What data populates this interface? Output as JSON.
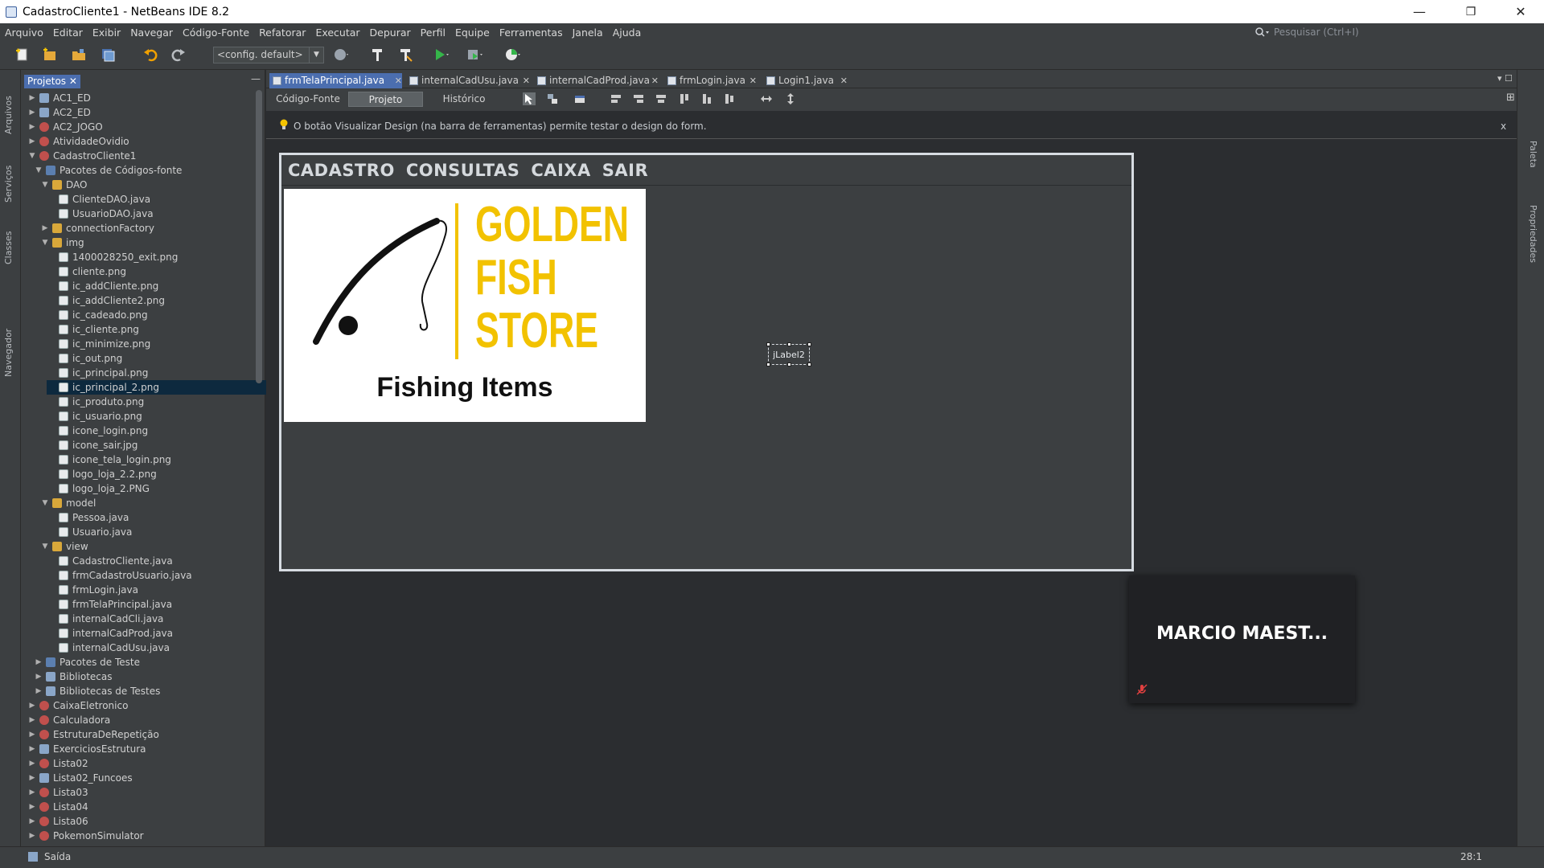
{
  "window": {
    "title": "CadastroCliente1 - NetBeans IDE 8.2",
    "minimize_glyph": "—",
    "restore_glyph": "❐",
    "close_glyph": "✕"
  },
  "menu": [
    {
      "label": "Arquivo"
    },
    {
      "label": "Editar"
    },
    {
      "label": "Exibir"
    },
    {
      "label": "Navegar"
    },
    {
      "label": "Código-Fonte"
    },
    {
      "label": "Refatorar"
    },
    {
      "label": "Executar"
    },
    {
      "label": "Depurar"
    },
    {
      "label": "Perfil"
    },
    {
      "label": "Equipe"
    },
    {
      "label": "Ferramentas"
    },
    {
      "label": "Janela"
    },
    {
      "label": "Ajuda"
    }
  ],
  "search": {
    "placeholder": "Pesquisar (Ctrl+I)"
  },
  "toolbar": {
    "config": "<config. default>"
  },
  "side_left": {
    "files": "Arquivos",
    "services": "Serviços",
    "classes": "Classes",
    "navigator": "Navegador"
  },
  "side_right": {
    "palette": "Paleta",
    "properties": "Propriedades"
  },
  "projects": {
    "tab_label": "Projetos",
    "tree": [
      {
        "label": "AC1_ED",
        "depth": 0,
        "toggle": "▶",
        "icon": "lib"
      },
      {
        "label": "AC2_ED",
        "depth": 0,
        "toggle": "▶",
        "icon": "lib"
      },
      {
        "label": "AC2_JOGO",
        "depth": 0,
        "toggle": "▶",
        "icon": "proj"
      },
      {
        "label": "AtividadeOvidio",
        "depth": 0,
        "toggle": "▶",
        "icon": "proj"
      },
      {
        "label": "CadastroCliente1",
        "depth": 0,
        "toggle": "▼",
        "icon": "proj"
      },
      {
        "label": "Pacotes de Códigos-fonte",
        "depth": 1,
        "toggle": "▼",
        "icon": "src"
      },
      {
        "label": "DAO",
        "depth": 2,
        "toggle": "▼",
        "icon": "pkg"
      },
      {
        "label": "ClienteDAO.java",
        "depth": 3,
        "toggle": "",
        "icon": "file"
      },
      {
        "label": "UsuarioDAO.java",
        "depth": 3,
        "toggle": "",
        "icon": "file"
      },
      {
        "label": "connectionFactory",
        "depth": 2,
        "toggle": "▶",
        "icon": "pkg"
      },
      {
        "label": "img",
        "depth": 2,
        "toggle": "▼",
        "icon": "pkg"
      },
      {
        "label": "1400028250_exit.png",
        "depth": 3,
        "toggle": "",
        "icon": "file"
      },
      {
        "label": "cliente.png",
        "depth": 3,
        "toggle": "",
        "icon": "file"
      },
      {
        "label": "ic_addCliente.png",
        "depth": 3,
        "toggle": "",
        "icon": "file"
      },
      {
        "label": "ic_addCliente2.png",
        "depth": 3,
        "toggle": "",
        "icon": "file"
      },
      {
        "label": "ic_cadeado.png",
        "depth": 3,
        "toggle": "",
        "icon": "file"
      },
      {
        "label": "ic_cliente.png",
        "depth": 3,
        "toggle": "",
        "icon": "file"
      },
      {
        "label": "ic_minimize.png",
        "depth": 3,
        "toggle": "",
        "icon": "file"
      },
      {
        "label": "ic_out.png",
        "depth": 3,
        "toggle": "",
        "icon": "file"
      },
      {
        "label": "ic_principal.png",
        "depth": 3,
        "toggle": "",
        "icon": "file"
      },
      {
        "label": "ic_principal_2.png",
        "depth": 3,
        "toggle": "",
        "icon": "file",
        "selected": true
      },
      {
        "label": "ic_produto.png",
        "depth": 3,
        "toggle": "",
        "icon": "file"
      },
      {
        "label": "ic_usuario.png",
        "depth": 3,
        "toggle": "",
        "icon": "file"
      },
      {
        "label": "icone_login.png",
        "depth": 3,
        "toggle": "",
        "icon": "file"
      },
      {
        "label": "icone_sair.jpg",
        "depth": 3,
        "toggle": "",
        "icon": "file"
      },
      {
        "label": "icone_tela_login.png",
        "depth": 3,
        "toggle": "",
        "icon": "file"
      },
      {
        "label": "logo_loja_2.2.png",
        "depth": 3,
        "toggle": "",
        "icon": "file"
      },
      {
        "label": "logo_loja_2.PNG",
        "depth": 3,
        "toggle": "",
        "icon": "file"
      },
      {
        "label": "model",
        "depth": 2,
        "toggle": "▼",
        "icon": "pkg"
      },
      {
        "label": "Pessoa.java",
        "depth": 3,
        "toggle": "",
        "icon": "file"
      },
      {
        "label": "Usuario.java",
        "depth": 3,
        "toggle": "",
        "icon": "file"
      },
      {
        "label": "view",
        "depth": 2,
        "toggle": "▼",
        "icon": "pkg"
      },
      {
        "label": "CadastroCliente.java",
        "depth": 3,
        "toggle": "",
        "icon": "file"
      },
      {
        "label": "frmCadastroUsuario.java",
        "depth": 3,
        "toggle": "",
        "icon": "file"
      },
      {
        "label": "frmLogin.java",
        "depth": 3,
        "toggle": "",
        "icon": "file"
      },
      {
        "label": "frmTelaPrincipal.java",
        "depth": 3,
        "toggle": "",
        "icon": "file"
      },
      {
        "label": "internalCadCli.java",
        "depth": 3,
        "toggle": "",
        "icon": "file"
      },
      {
        "label": "internalCadProd.java",
        "depth": 3,
        "toggle": "",
        "icon": "file"
      },
      {
        "label": "internalCadUsu.java",
        "depth": 3,
        "toggle": "",
        "icon": "file"
      },
      {
        "label": "Pacotes de Teste",
        "depth": 1,
        "toggle": "▶",
        "icon": "src"
      },
      {
        "label": "Bibliotecas",
        "depth": 1,
        "toggle": "▶",
        "icon": "lib"
      },
      {
        "label": "Bibliotecas de Testes",
        "depth": 1,
        "toggle": "▶",
        "icon": "lib"
      },
      {
        "label": "CaixaEletronico",
        "depth": 0,
        "toggle": "▶",
        "icon": "proj"
      },
      {
        "label": "Calculadora",
        "depth": 0,
        "toggle": "▶",
        "icon": "proj"
      },
      {
        "label": "EstruturaDeRepetição",
        "depth": 0,
        "toggle": "▶",
        "icon": "proj"
      },
      {
        "label": "ExerciciosEstrutura",
        "depth": 0,
        "toggle": "▶",
        "icon": "lib"
      },
      {
        "label": "Lista02",
        "depth": 0,
        "toggle": "▶",
        "icon": "proj"
      },
      {
        "label": "Lista02_Funcoes",
        "depth": 0,
        "toggle": "▶",
        "icon": "lib"
      },
      {
        "label": "Lista03",
        "depth": 0,
        "toggle": "▶",
        "icon": "proj"
      },
      {
        "label": "Lista04",
        "depth": 0,
        "toggle": "▶",
        "icon": "proj"
      },
      {
        "label": "Lista06",
        "depth": 0,
        "toggle": "▶",
        "icon": "proj"
      },
      {
        "label": "PokemonSimulator",
        "depth": 0,
        "toggle": "▶",
        "icon": "proj"
      }
    ]
  },
  "editor_tabs": [
    {
      "label": "frmTelaPrincipal.java",
      "active": true
    },
    {
      "label": "internalCadUsu.java",
      "active": false
    },
    {
      "label": "internalCadProd.java",
      "active": false
    },
    {
      "label": "frmLogin.java",
      "active": false
    },
    {
      "label": "Login1.java",
      "active": false
    }
  ],
  "views": {
    "source": "Código-Fonte",
    "design": "Projeto",
    "history": "Histórico"
  },
  "hint": {
    "text": "O botão Visualizar Design (na barra de ferramentas) permite testar o design do form.",
    "close": "x"
  },
  "form": {
    "menu": [
      "CADASTRO",
      "CONSULTAS",
      "CAIXA",
      "SAIR"
    ],
    "logo": {
      "line1": "GOLDEN",
      "line2": "FISH",
      "line3": "STORE",
      "tagline": "Fishing Items"
    },
    "label2": "jLabel2"
  },
  "overlay": {
    "name": "MARCIO  MAEST..."
  },
  "status": {
    "output": "Saída",
    "position": "28:1"
  },
  "colors": {
    "accent": "#4b6eaf",
    "logo_gold": "#f2c200",
    "panel": "#3c3f41",
    "canvas": "#2b2d30"
  }
}
